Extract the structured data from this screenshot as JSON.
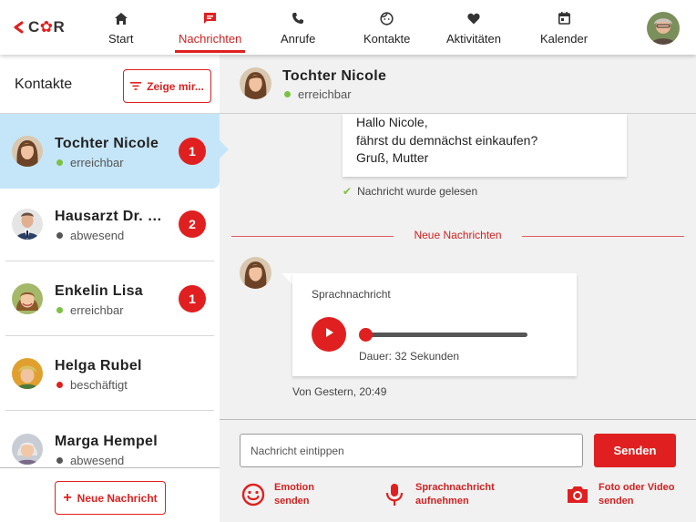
{
  "brand": {
    "logo_text": "C",
    "logo_text2": "R"
  },
  "nav": {
    "items": [
      {
        "label": "Start",
        "icon": "home-icon"
      },
      {
        "label": "Nachrichten",
        "icon": "chat-icon",
        "active": true
      },
      {
        "label": "Anrufe",
        "icon": "phone-icon"
      },
      {
        "label": "Kontakte",
        "icon": "face-icon"
      },
      {
        "label": "Aktivitäten",
        "icon": "heart-icon"
      },
      {
        "label": "Kalender",
        "icon": "calendar-icon"
      }
    ]
  },
  "sidebar": {
    "title": "Kontakte",
    "filter_label": "Zeige mir...",
    "contacts": [
      {
        "name": "Tochter Nicole",
        "status": "erreichbar",
        "status_color": "#7cc242",
        "badge": "1"
      },
      {
        "name": "Hausarzt Dr. St...",
        "status": "abwesend",
        "status_color": "#555555",
        "badge": "2"
      },
      {
        "name": "Enkelin Lisa",
        "status": "erreichbar",
        "status_color": "#7cc242",
        "badge": "1"
      },
      {
        "name": "Helga Rubel",
        "status": "beschäftigt",
        "status_color": "#e02020",
        "badge": ""
      },
      {
        "name": "Marga Hempel",
        "status": "abwesend",
        "status_color": "#555555",
        "badge": ""
      }
    ],
    "new_message_label": "Neue Nachricht"
  },
  "chat": {
    "header": {
      "name": "Tochter Nicole",
      "status": "erreichbar"
    },
    "outgoing": {
      "lines": [
        "Hallo Nicole,",
        "fährst du demnächst einkaufen?",
        "Gruß, Mutter"
      ]
    },
    "read_receipt": "Nachricht wurde gelesen",
    "divider_label": "Neue Nachrichten",
    "incoming": {
      "type_label": "Sprachnachricht",
      "duration": "Dauer: 32 Sekunden",
      "progress": 0,
      "timestamp": "Von Gestern, 20:49"
    },
    "compose": {
      "placeholder": "Nachricht eintippen",
      "send_label": "Senden",
      "actions": [
        {
          "line1": "Emotion",
          "line2": "senden",
          "icon": "smiley-icon"
        },
        {
          "line1": "Sprachnachricht",
          "line2": "aufnehmen",
          "icon": "microphone-icon"
        },
        {
          "line1": "Foto oder Video",
          "line2": "senden",
          "icon": "camera-icon"
        }
      ]
    }
  },
  "colors": {
    "accent": "#e02020",
    "active_bg": "#c5e6f8",
    "online": "#7cc242"
  }
}
